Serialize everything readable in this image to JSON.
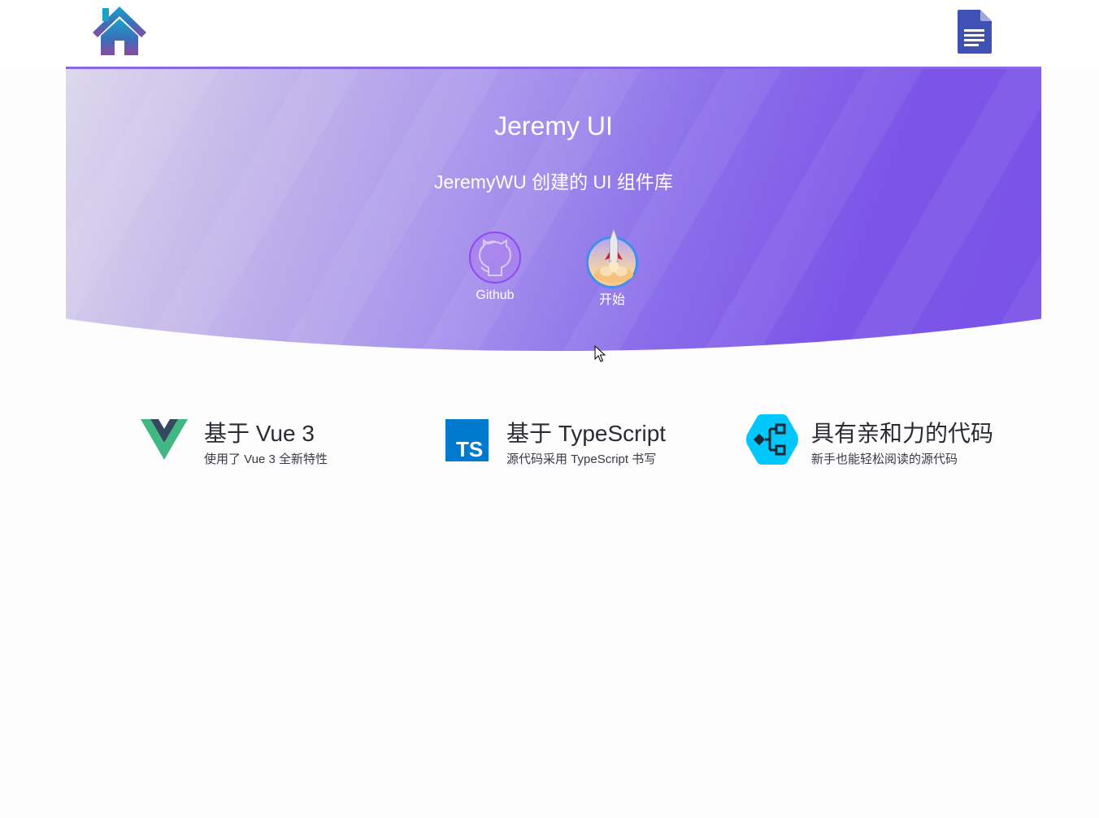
{
  "header": {
    "logo_icon": "home-icon",
    "docs_icon": "document-icon"
  },
  "hero": {
    "title": "Jeremy UI",
    "subtitle": "JeremyWU 创建的 UI 组件库",
    "actions": [
      {
        "label": "Github",
        "icon": "github-octocat-icon"
      },
      {
        "label": "开始",
        "icon": "rocket-launch-icon"
      }
    ]
  },
  "features": [
    {
      "icon": "vue-logo-icon",
      "title": "基于 Vue 3",
      "description": "使用了 Vue 3 全新特性"
    },
    {
      "icon": "typescript-logo-icon",
      "title": "基于 TypeScript",
      "description": "源代码采用 TypeScript 书写"
    },
    {
      "icon": "code-structure-icon",
      "title": "具有亲和力的代码",
      "description": "新手也能轻松阅读的源代码"
    }
  ],
  "colors": {
    "hero_start": "#dcd8ec",
    "hero_end": "#7a52e8",
    "vue_green": "#41b883",
    "vue_dark": "#34495e",
    "ts_blue": "#007acc",
    "code_cyan": "#00c8ff",
    "docs_blue": "#3f51b5"
  }
}
